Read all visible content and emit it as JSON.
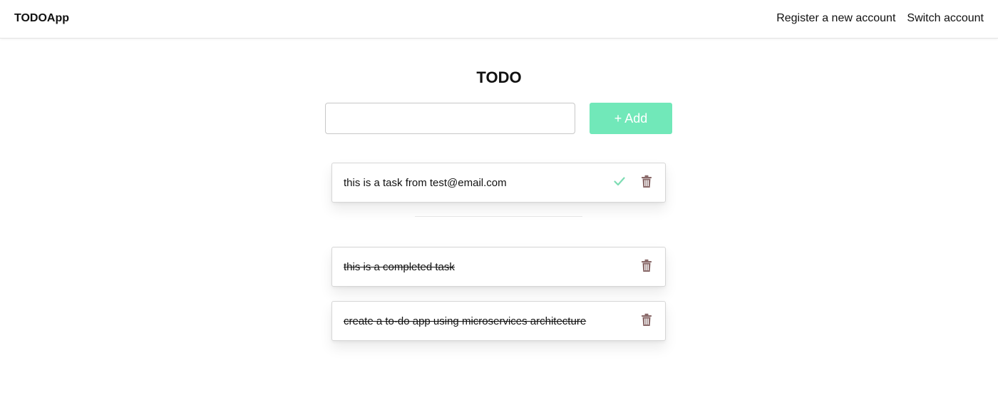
{
  "navbar": {
    "brand": "TODOApp",
    "links": [
      "Register a new account",
      "Switch account"
    ]
  },
  "main": {
    "title": "TODO",
    "input": {
      "value": "",
      "placeholder": ""
    },
    "add_button": {
      "label": "+ Add"
    }
  },
  "tasks": {
    "active": [
      {
        "text": "this is a task from test@email.com"
      }
    ],
    "completed": [
      {
        "text": "this is a completed task"
      },
      {
        "text": "create a to-do app using microservices architecture"
      }
    ]
  },
  "colors": {
    "accent": "#71e8b9",
    "check": "#7ddcb3",
    "trash": "#8a6a6a"
  },
  "icons": {
    "complete": "check-icon",
    "delete": "trash-icon"
  }
}
